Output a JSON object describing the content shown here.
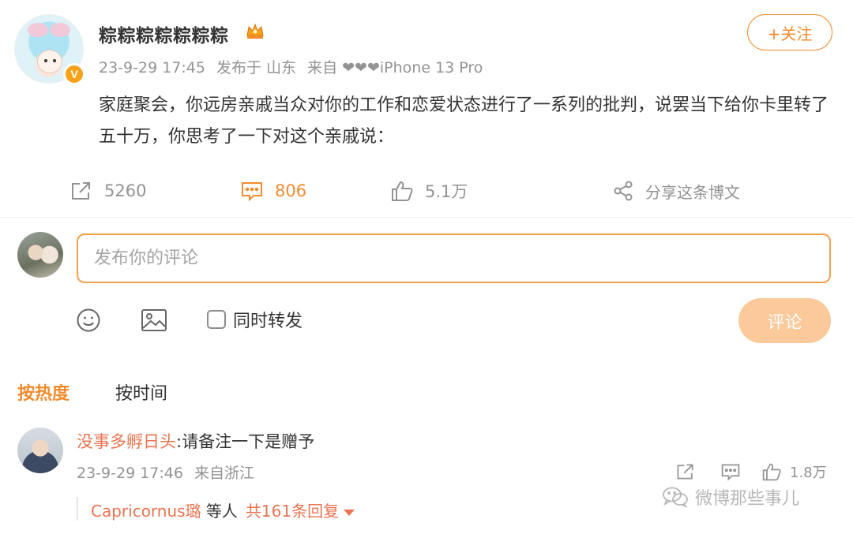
{
  "post": {
    "username": "粽粽粽粽粽粽粽",
    "follow_label": "+关注",
    "time": "23-9-29 17:45",
    "location": "发布于 山东",
    "source": "来自 ❤❤❤iPhone 13 Pro",
    "text": "家庭聚会，你远房亲戚当众对你的工作和恋爱状态进行了一系列的批判，说罢当下给你卡里转了五十万，你思考了一下对这个亲戚说：",
    "verified_badge": "V",
    "repost_count": "5260",
    "comment_count": "806",
    "like_count": "5.1万",
    "share_label": "分享这条博文"
  },
  "composer": {
    "placeholder": "发布你的评论",
    "repost_label": "同时转发",
    "submit_label": "评论"
  },
  "sort_tabs": {
    "hot": "按热度",
    "time": "按时间"
  },
  "comment": {
    "user": "没事多孵日头",
    "text": ":请备注一下是赠予",
    "time": "23-9-29 17:46",
    "source": "来自浙江",
    "like_count": "1.8万",
    "reply_user": "Capricornus璐",
    "reply_mid": " 等人",
    "reply_count": "共161条回复"
  },
  "watermark": "微博那些事儿",
  "colors": {
    "accent": "#f28b2e",
    "username_link": "#eb7350",
    "muted": "#939393",
    "submit_disabled": "#fcc99a"
  }
}
